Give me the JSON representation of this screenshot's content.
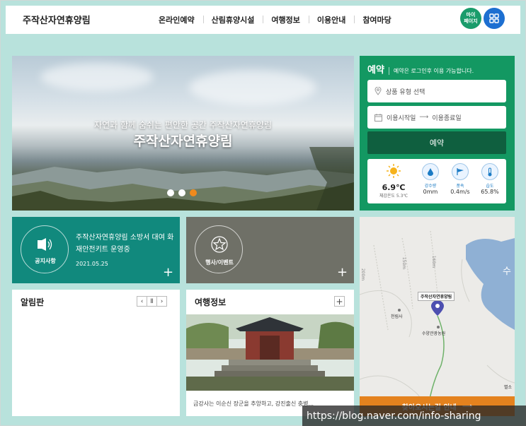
{
  "header": {
    "logo": "주작산자연휴양림",
    "nav": [
      "온라인예약",
      "산림휴양시설",
      "여행정보",
      "이용안내",
      "참여마당"
    ],
    "mypage_line1": "마이",
    "mypage_line2": "페이지"
  },
  "hero": {
    "subtitle": "자연과 함께 숨쉬는 편안한 공간 주작산자연휴양림",
    "title": "주작산자연휴양림",
    "slides": 3,
    "active_slide": 3
  },
  "reserve": {
    "title": "예약",
    "note": "예약은 로그인후 이용 가능합니다.",
    "product_placeholder": "상품 유형 선택",
    "start_placeholder": "이용시작일",
    "end_placeholder": "이용종료일",
    "button": "예약",
    "weather": {
      "temp": "6.9℃",
      "feel": "체감온도 5.3℃",
      "rain_label": "강수량",
      "rain_value": "0mm",
      "wind_label": "풍속",
      "wind_value": "0.4m/s",
      "humid_label": "습도",
      "humid_value": "65.8%"
    }
  },
  "notice": {
    "label": "공지사항",
    "text": "주작산자연휴양림 소방서 대여 화재안전키트 운영중",
    "date": "2021.05.25"
  },
  "event": {
    "label": "행사/이벤트"
  },
  "board": {
    "title": "알림판"
  },
  "travel": {
    "title": "여행정보",
    "caption": "금강사는 이순신 장군을 추앙하고, 강진출신 충병..."
  },
  "map": {
    "place_tag": "주작산자연휴양림",
    "temple_line1": "천림사",
    "garden": "수양관광농원",
    "sea_char": "수",
    "road1": "150m",
    "road2": "160m",
    "road3": "200m",
    "corner": "별소",
    "directions": "찾아오시는길 안내"
  },
  "watermark": "https://blog.naver.com/info-sharing",
  "colors": {
    "bg": "#b8e2dc",
    "reserve_green": "#139862",
    "notice_teal": "#11897d",
    "event_gray": "#6f7067",
    "orange": "#e4821e",
    "menu_blue": "#1d6fd1"
  }
}
